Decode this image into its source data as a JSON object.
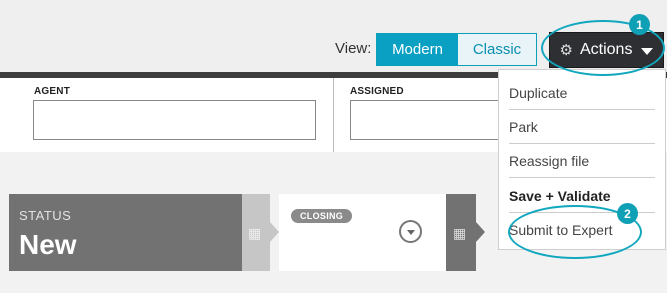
{
  "toolbar": {
    "view_label": "View:",
    "view_options": [
      "Modern",
      "Classic"
    ],
    "selected_view": "Modern",
    "actions_label": "Actions",
    "accent_color": "#0aa0c3"
  },
  "fields": {
    "agent_label": "AGENT",
    "assigned_label": "ASSIGNED"
  },
  "status": {
    "label": "STATUS",
    "value": "New",
    "stage_pill": "CLOSING"
  },
  "actions_menu": {
    "items": [
      "Duplicate",
      "Park",
      "Reassign file",
      "Save + Validate",
      "Submit to Expert"
    ]
  },
  "annotations": {
    "badge_1": "1",
    "badge_2": "2",
    "highlight_color": "#11a7bf"
  },
  "icons": [
    "gear-icon",
    "caret-down-icon",
    "calendar-icon",
    "dropdown-circle-icon"
  ]
}
